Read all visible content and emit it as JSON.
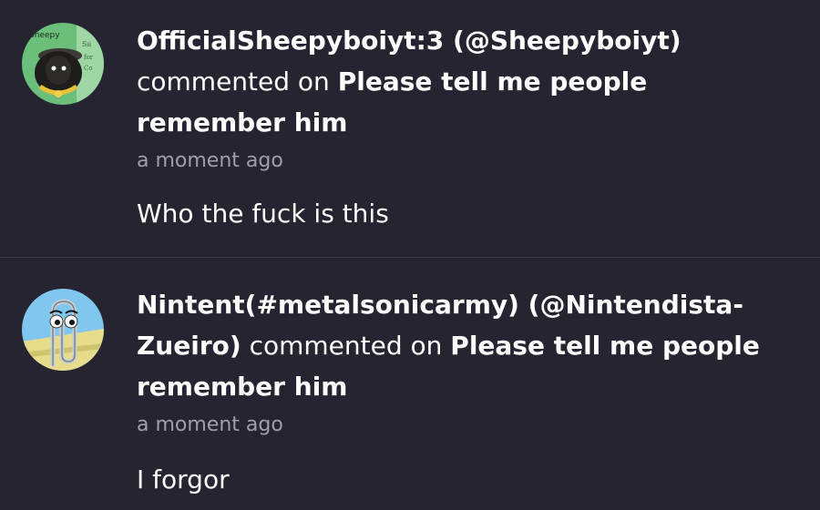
{
  "notifications": [
    {
      "user_name": "OfficialSheepyboiyt:3 (@Sheepyboiyt)",
      "action": "commented on",
      "post_title": "Please tell me people remember him",
      "time": "a moment ago",
      "comment": "Who the fuck is this",
      "avatar_icon": "sheep-avatar-icon",
      "avatar_text": "Sheepy"
    },
    {
      "user_name": "Nintent(#metalsonicarmy) (@Nintendista-Zueiro)",
      "action": "commented on",
      "post_title": "Please tell me people remember him",
      "time": "a moment ago",
      "comment": "I forgor",
      "avatar_icon": "paperclip-avatar-icon"
    }
  ],
  "colors": {
    "background": "#252430",
    "divider": "#3d3c48",
    "text": "#ffffff",
    "muted_text": "#a09fa8"
  }
}
